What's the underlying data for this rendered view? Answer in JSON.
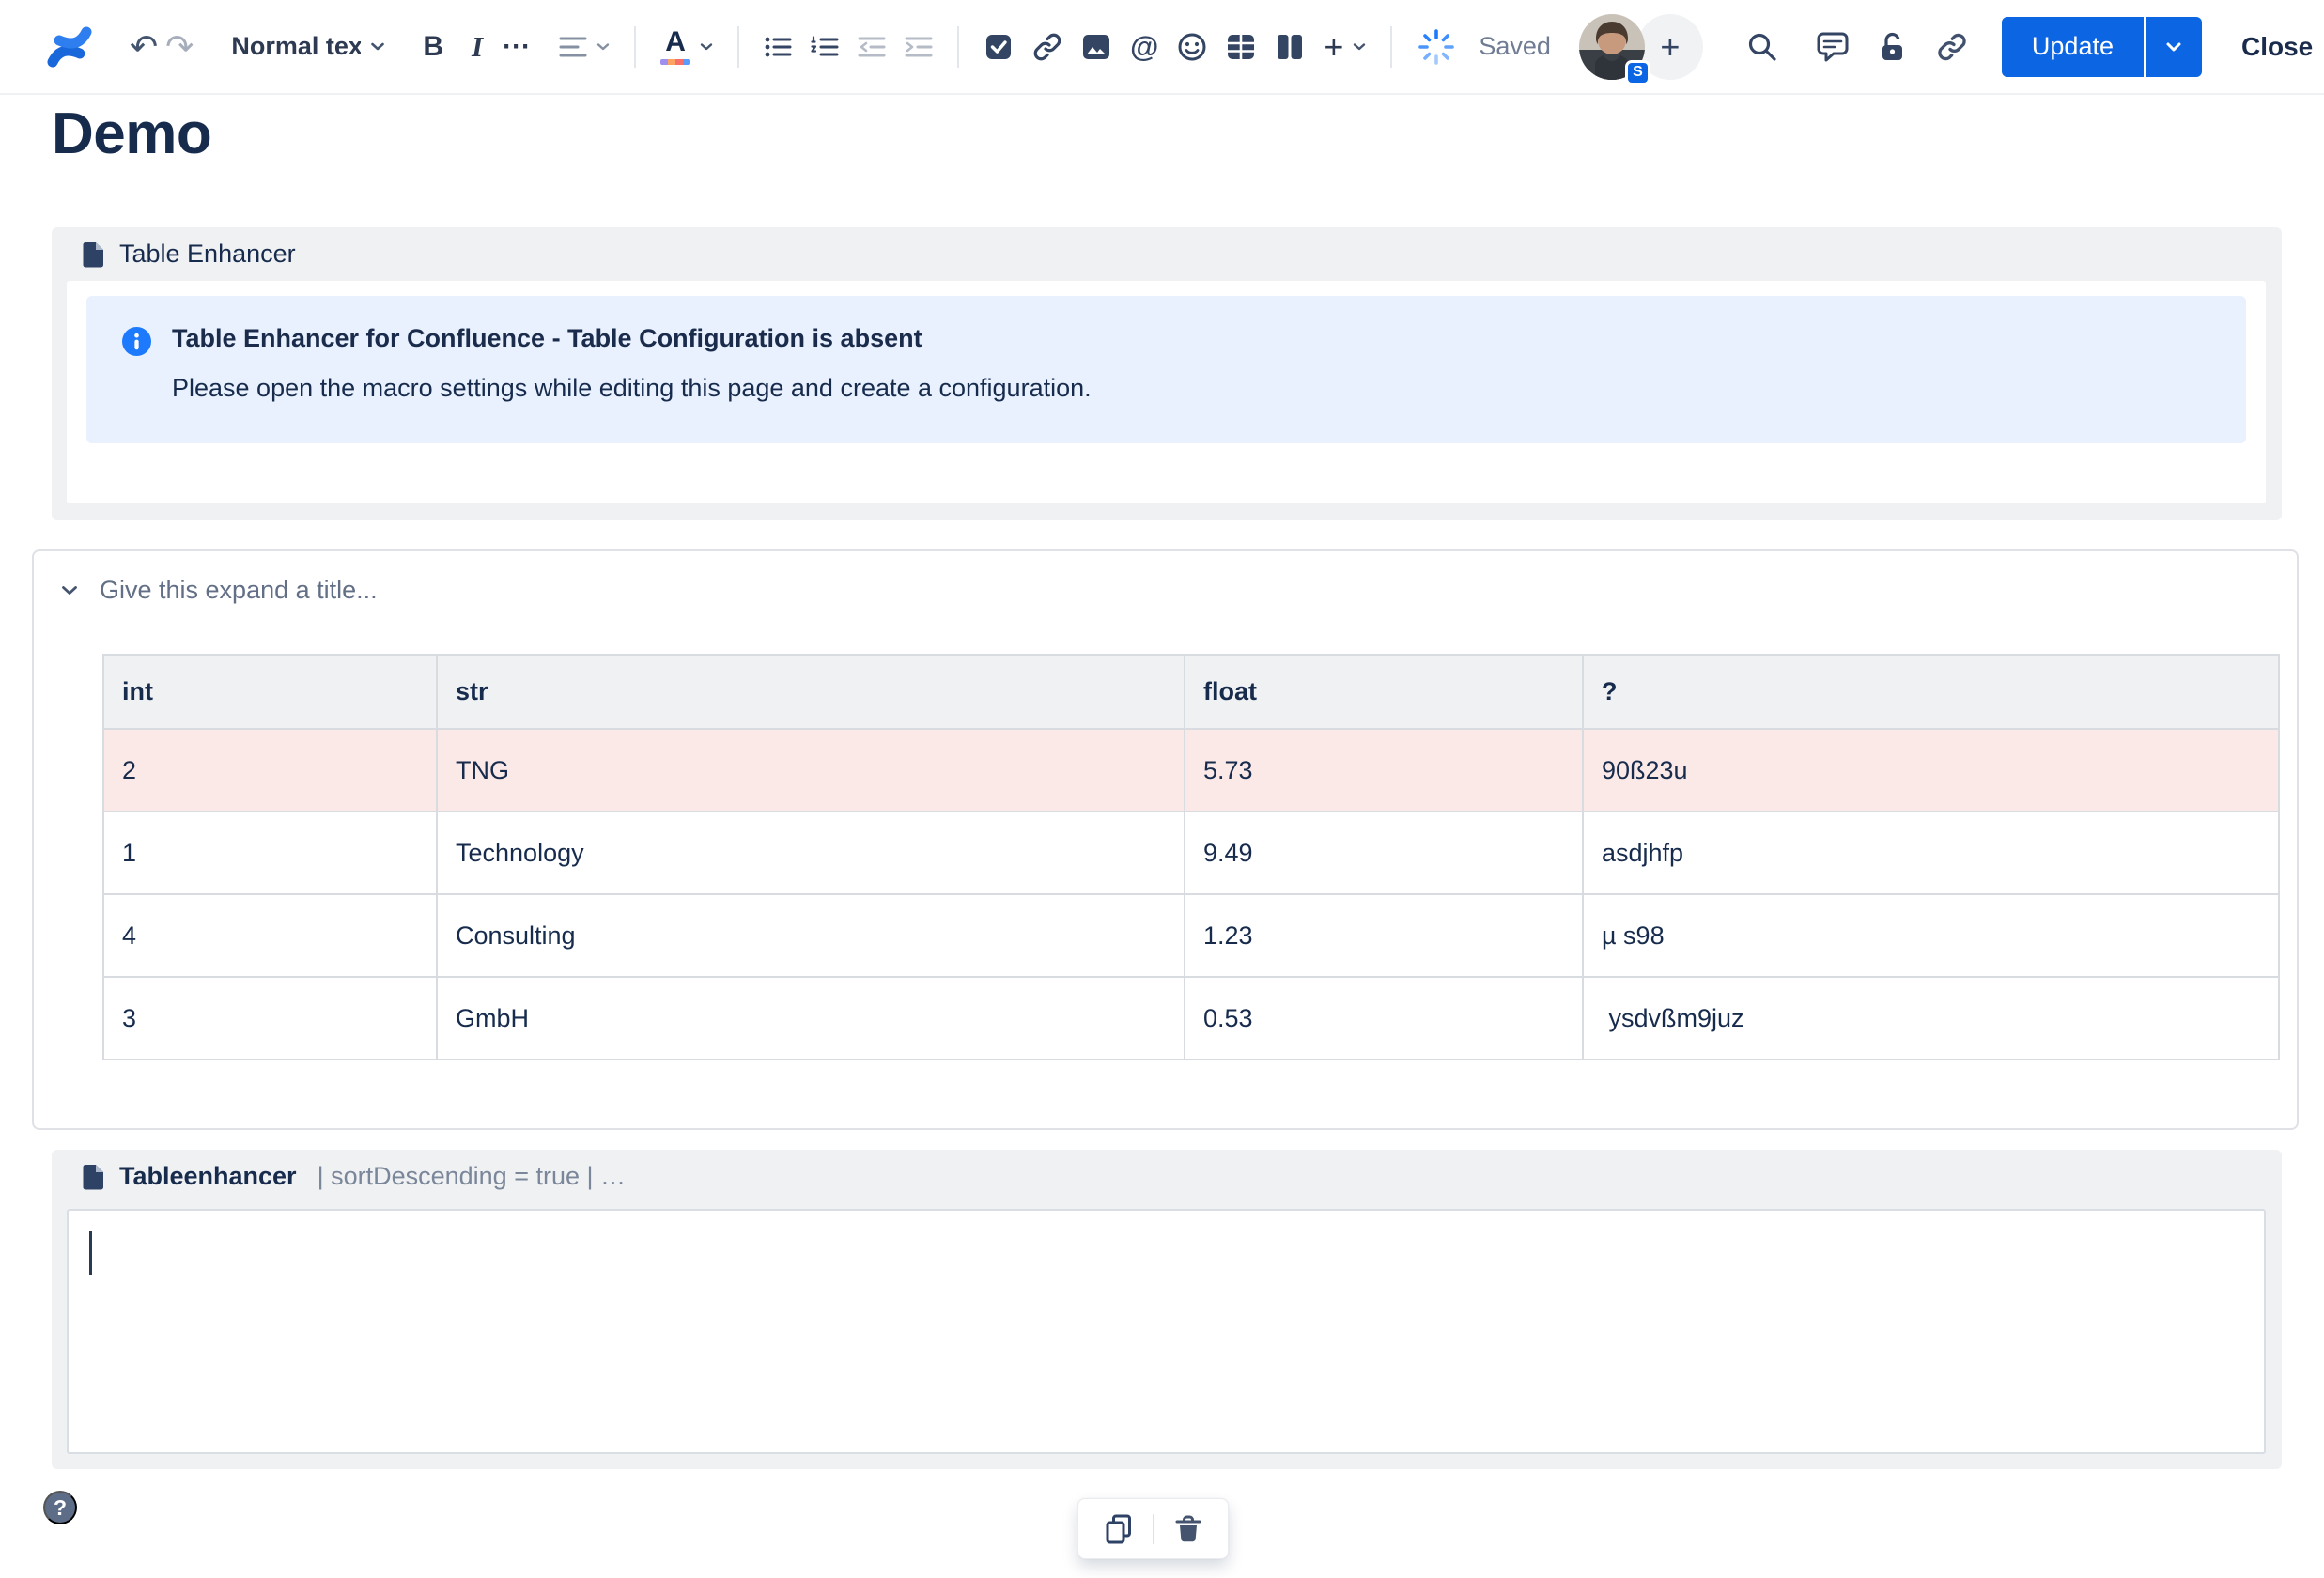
{
  "toolbar": {
    "undo_glyph": "↶",
    "redo_glyph": "↷",
    "text_style": "Normal text",
    "bold_glyph": "B",
    "italic_glyph": "I",
    "more_formatting_glyph": "⋯",
    "color_letter": "A",
    "mention_glyph": "@",
    "insert_plus_glyph": "+",
    "save_status": "Saved",
    "avatar_badge": "S",
    "plus_people_glyph": "+",
    "update_label": "Update",
    "close_label": "Close",
    "more_actions_glyph": "⋯",
    "accent_blue": "#0C66E4",
    "spinner_blue": "#1D7AFC"
  },
  "page": {
    "title": "Demo"
  },
  "table_enhancer_macro": {
    "label": "Table Enhancer",
    "info": {
      "title": "Table Enhancer for Confluence - Table Configuration is absent",
      "body": "Please open the macro settings while editing this page and create a configuration.",
      "background": "#E8F1FD",
      "icon_color": "#1D7AFC"
    }
  },
  "expand": {
    "placeholder": "Give this expand a title...",
    "table": {
      "headers": [
        "int",
        "str",
        "float",
        "?"
      ],
      "rows": [
        [
          "2",
          "TNG",
          "5.73",
          "90ß23u"
        ],
        [
          "1",
          "Technology",
          "9.49",
          "asdjhfp"
        ],
        [
          "4",
          "Consulting",
          "1.23",
          "µ s98"
        ],
        [
          "3",
          "GmbH",
          "0.53",
          " ysdvßm9juz"
        ]
      ],
      "highlighted_row_index": 0,
      "highlight_color": "#FBE9E7"
    }
  },
  "tableenhancer_macro": {
    "name": "Tableenhancer",
    "params": "| sortDescending = true | …"
  },
  "help_button_glyph": "?"
}
